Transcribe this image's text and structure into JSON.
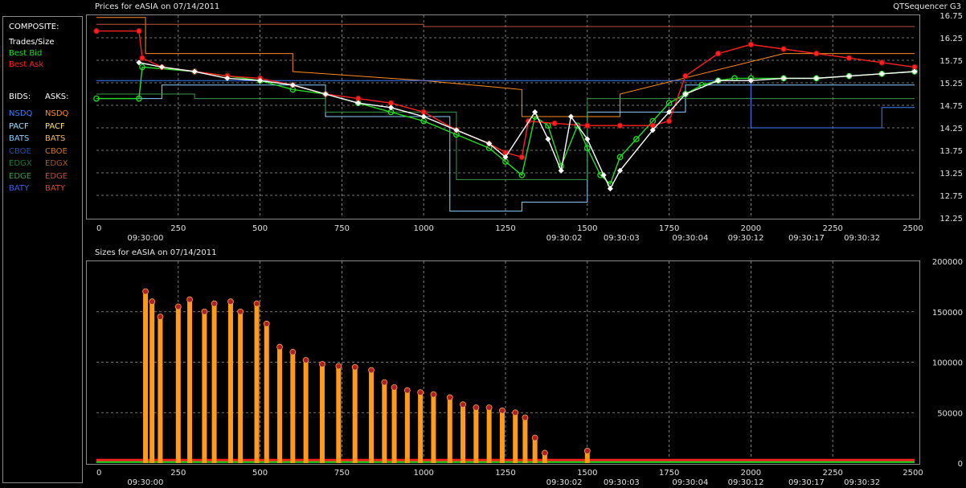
{
  "legend": {
    "composite_header": "COMPOSITE:",
    "trades": "Trades/Size",
    "best_bid": "Best Bid",
    "best_ask": "Best Ask",
    "bids_header": "BIDS:",
    "asks_header": "ASKS:",
    "bids": [
      {
        "label": "NSDQ",
        "color": "#3b7fff"
      },
      {
        "label": "PACF",
        "color": "#9fe0ff"
      },
      {
        "label": "BATS",
        "color": "#8ad0ff"
      },
      {
        "label": "CBOE",
        "color": "#2050b0"
      },
      {
        "label": "EDGX",
        "color": "#1c7a3a"
      },
      {
        "label": "EDGE",
        "color": "#3a9a4a"
      },
      {
        "label": "BATY",
        "color": "#4060e0"
      }
    ],
    "asks": [
      {
        "label": "NSDQ",
        "color": "#ff8c1a"
      },
      {
        "label": "PACF",
        "color": "#ffe070"
      },
      {
        "label": "BATS",
        "color": "#f4b860"
      },
      {
        "label": "CBOE",
        "color": "#c87a30"
      },
      {
        "label": "EDGX",
        "color": "#a05a2a"
      },
      {
        "label": "EDGE",
        "color": "#c05040"
      },
      {
        "label": "BATY",
        "color": "#e04a2a"
      }
    ],
    "colors": {
      "composite": "#ffffff",
      "trades": "#ffffff",
      "best_bid": "#22dd22",
      "best_ask": "#ff2020"
    }
  },
  "top": {
    "title": "Prices for  eASIA  on  07/14/2011",
    "right_label": "QTSequencer G3"
  },
  "bottom": {
    "title": "Sizes for  eASIA  on  07/14/2011"
  },
  "chart_data": [
    {
      "type": "line",
      "title": "Prices for  eASIA  on  07/14/2011",
      "xlim": [
        0,
        2500
      ],
      "ylim": [
        12.25,
        16.75
      ],
      "x_ticks": [
        0,
        250,
        500,
        750,
        1000,
        1250,
        1500,
        1750,
        2000,
        2250,
        2500
      ],
      "y_ticks": [
        12.25,
        12.75,
        13.25,
        13.75,
        14.25,
        14.75,
        15.25,
        15.75,
        16.25,
        16.75
      ],
      "time_labels": [
        {
          "x": 120,
          "label": "09:30:00"
        },
        {
          "x": 1400,
          "label": "09:30:02"
        },
        {
          "x": 1575,
          "label": "09:30:03"
        },
        {
          "x": 1785,
          "label": "09:30:04"
        },
        {
          "x": 1955,
          "label": "09:30:12"
        },
        {
          "x": 2140,
          "label": "09:30:17"
        },
        {
          "x": 2310,
          "label": "09:30:32"
        }
      ],
      "grid": true,
      "series": [
        {
          "name": "Best Bid",
          "points": [
            [
              0,
              14.9
            ],
            [
              130,
              14.9
            ],
            [
              140,
              15.6
            ],
            [
              300,
              15.5
            ],
            [
              400,
              15.4
            ],
            [
              500,
              15.3
            ],
            [
              600,
              15.1
            ],
            [
              700,
              15.0
            ],
            [
              800,
              14.8
            ],
            [
              900,
              14.6
            ],
            [
              1000,
              14.4
            ],
            [
              1100,
              14.1
            ],
            [
              1200,
              13.8
            ],
            [
              1250,
              13.5
            ],
            [
              1300,
              13.2
            ],
            [
              1340,
              14.5
            ],
            [
              1380,
              14.3
            ],
            [
              1420,
              13.4
            ],
            [
              1470,
              14.3
            ],
            [
              1500,
              13.8
            ],
            [
              1540,
              13.2
            ],
            [
              1570,
              13.0
            ],
            [
              1600,
              13.6
            ],
            [
              1650,
              14.0
            ],
            [
              1700,
              14.4
            ],
            [
              1750,
              14.8
            ],
            [
              1800,
              15.0
            ],
            [
              1850,
              15.2
            ],
            [
              1900,
              15.3
            ],
            [
              1950,
              15.35
            ],
            [
              2000,
              15.35
            ],
            [
              2100,
              15.35
            ],
            [
              2200,
              15.35
            ],
            [
              2300,
              15.4
            ],
            [
              2400,
              15.45
            ],
            [
              2500,
              15.5
            ]
          ]
        },
        {
          "name": "Best Ask",
          "points": [
            [
              0,
              16.4
            ],
            [
              130,
              16.4
            ],
            [
              140,
              15.8
            ],
            [
              200,
              15.6
            ],
            [
              300,
              15.5
            ],
            [
              400,
              15.4
            ],
            [
              500,
              15.35
            ],
            [
              600,
              15.2
            ],
            [
              700,
              15.0
            ],
            [
              800,
              14.9
            ],
            [
              900,
              14.8
            ],
            [
              1000,
              14.6
            ],
            [
              1100,
              14.2
            ],
            [
              1200,
              13.9
            ],
            [
              1250,
              13.7
            ],
            [
              1300,
              13.6
            ],
            [
              1320,
              14.4
            ],
            [
              1400,
              14.35
            ],
            [
              1500,
              14.3
            ],
            [
              1600,
              14.3
            ],
            [
              1700,
              14.3
            ],
            [
              1750,
              14.4
            ],
            [
              1800,
              15.4
            ],
            [
              1900,
              15.9
            ],
            [
              2000,
              16.1
            ],
            [
              2100,
              16.0
            ],
            [
              2200,
              15.9
            ],
            [
              2300,
              15.8
            ],
            [
              2400,
              15.7
            ],
            [
              2500,
              15.6
            ]
          ]
        },
        {
          "name": "Trades/Size",
          "points": [
            [
              130,
              15.7
            ],
            [
              200,
              15.6
            ],
            [
              300,
              15.5
            ],
            [
              400,
              15.35
            ],
            [
              500,
              15.3
            ],
            [
              600,
              15.2
            ],
            [
              700,
              15.0
            ],
            [
              800,
              14.8
            ],
            [
              900,
              14.7
            ],
            [
              1000,
              14.5
            ],
            [
              1100,
              14.2
            ],
            [
              1200,
              13.9
            ],
            [
              1250,
              13.6
            ],
            [
              1340,
              14.6
            ],
            [
              1380,
              14.0
            ],
            [
              1420,
              13.3
            ],
            [
              1450,
              14.5
            ],
            [
              1500,
              14.0
            ],
            [
              1550,
              13.2
            ],
            [
              1570,
              12.9
            ],
            [
              1600,
              13.3
            ],
            [
              1700,
              14.2
            ],
            [
              1750,
              14.6
            ],
            [
              1800,
              15.0
            ],
            [
              1900,
              15.3
            ],
            [
              2000,
              15.3
            ],
            [
              2100,
              15.35
            ],
            [
              2200,
              15.35
            ],
            [
              2300,
              15.4
            ],
            [
              2400,
              15.45
            ],
            [
              2500,
              15.5
            ]
          ]
        }
      ]
    },
    {
      "type": "bar",
      "title": "Sizes for  eASIA  on  07/14/2011",
      "xlim": [
        0,
        2500
      ],
      "ylim": [
        0,
        200000
      ],
      "x_ticks": [
        0,
        250,
        500,
        750,
        1000,
        1250,
        1500,
        1750,
        2000,
        2250,
        2500
      ],
      "y_ticks": [
        0,
        50000,
        100000,
        150000,
        200000
      ],
      "time_labels": [
        {
          "x": 120,
          "label": "09:30:00"
        },
        {
          "x": 1400,
          "label": "09:30:02"
        },
        {
          "x": 1575,
          "label": "09:30:03"
        },
        {
          "x": 1785,
          "label": "09:30:04"
        },
        {
          "x": 1955,
          "label": "09:30:12"
        },
        {
          "x": 2140,
          "label": "09:30:17"
        },
        {
          "x": 2310,
          "label": "09:30:32"
        }
      ],
      "grid": true,
      "series": [
        {
          "name": "Trades/Size",
          "points": [
            [
              150,
              170000
            ],
            [
              170,
              160000
            ],
            [
              195,
              145000
            ],
            [
              250,
              155000
            ],
            [
              285,
              162000
            ],
            [
              330,
              150000
            ],
            [
              360,
              158000
            ],
            [
              410,
              160000
            ],
            [
              440,
              150000
            ],
            [
              490,
              158000
            ],
            [
              520,
              138000
            ],
            [
              560,
              115000
            ],
            [
              600,
              110000
            ],
            [
              640,
              102000
            ],
            [
              690,
              98000
            ],
            [
              740,
              96000
            ],
            [
              790,
              95000
            ],
            [
              840,
              92000
            ],
            [
              880,
              80000
            ],
            [
              910,
              75000
            ],
            [
              950,
              72000
            ],
            [
              990,
              70000
            ],
            [
              1030,
              68000
            ],
            [
              1080,
              65000
            ],
            [
              1120,
              58000
            ],
            [
              1160,
              55000
            ],
            [
              1200,
              55000
            ],
            [
              1240,
              52000
            ],
            [
              1280,
              50000
            ],
            [
              1310,
              45000
            ],
            [
              1340,
              25000
            ],
            [
              1370,
              10000
            ],
            [
              1500,
              12000
            ]
          ]
        }
      ]
    }
  ]
}
